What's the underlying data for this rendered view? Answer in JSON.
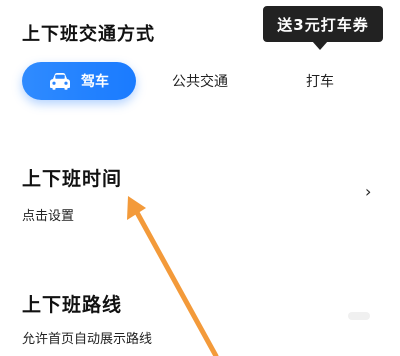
{
  "commute": {
    "title": "上下班交通方式",
    "promo_tooltip": "送3元打车券",
    "modes": {
      "drive": "驾车",
      "transit": "公共交通",
      "taxi": "打车"
    },
    "selected_mode": "驾车"
  },
  "commute_time": {
    "title": "上下班时间",
    "subtitle": "点击设置"
  },
  "commute_route": {
    "title": "上下班路线",
    "subtitle": "允许首页自动展示路线"
  },
  "colors": {
    "accent": "#1a7bff",
    "tooltip_bg": "#222222",
    "annotation_arrow": "#f39a3a"
  },
  "icons": {
    "drive": "car-icon",
    "disclosure": "chevron-right-icon"
  }
}
